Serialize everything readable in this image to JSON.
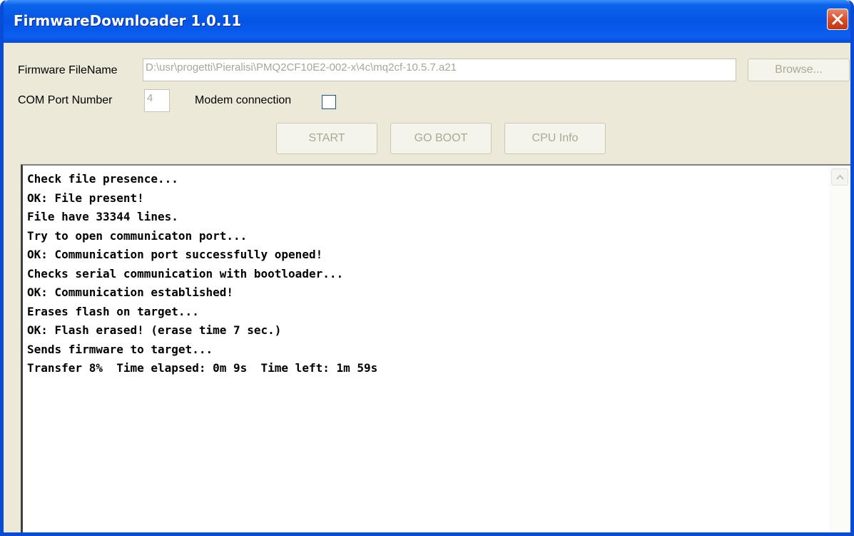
{
  "window": {
    "title": "FirmwareDownloader 1.0.11"
  },
  "form": {
    "firmware_label": "Firmware FileName",
    "firmware_path": "D:\\usr\\progetti\\Pieralisi\\PMQ2CF10E2-002-x\\4c\\mq2cf-10.5.7.a21",
    "browse_label": "Browse...",
    "com_port_label": "COM Port Number",
    "com_port_value": "4",
    "modem_label": "Modem connection",
    "modem_checked": false
  },
  "buttons": {
    "start": "START",
    "go_boot": "GO BOOT",
    "cpu_info": "CPU Info"
  },
  "log": {
    "lines": [
      "Check file presence...",
      "OK: File present!",
      "File have 33344 lines.",
      "Try to open communicaton port...",
      "OK: Communication port successfully opened!",
      "Checks serial communication with bootloader...",
      "OK: Communication established!",
      "Erases flash on target...",
      "OK: Flash erased! (erase time 7 sec.)",
      "Sends firmware to target...",
      "Transfer 8%  Time elapsed: 0m 9s  Time left: 1m 59s"
    ]
  },
  "icons": {
    "close": "close-icon",
    "scroll_up": "arrow-up-icon",
    "scroll_down": "arrow-down-icon"
  },
  "colors": {
    "titlebar": "#0654e6",
    "close_button": "#d6502c",
    "window_background": "#ece9d8",
    "disabled_text": "#aca899"
  }
}
